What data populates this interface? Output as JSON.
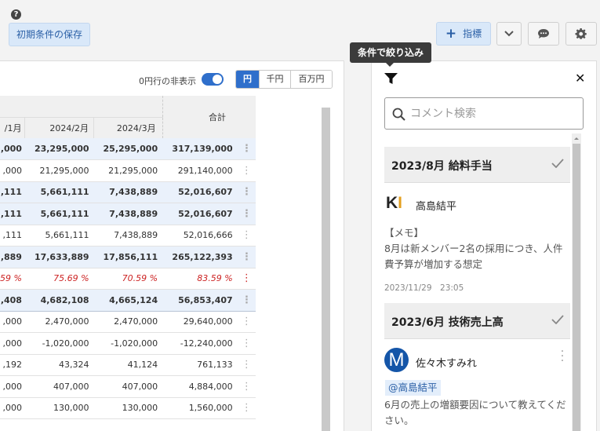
{
  "toolbar": {
    "help_glyph": "?",
    "save_conditions": "初期条件の保存",
    "metric_plus": "+",
    "metric_label": "指標",
    "filter_tooltip": "条件で絞り込み"
  },
  "table_panel": {
    "hide_zero_label": "0円行の非表示",
    "units": [
      "円",
      "千円",
      "百万円"
    ],
    "active_unit": "円",
    "headers": [
      "/1月",
      "2024/2月",
      "2024/3月"
    ],
    "total_header": "合計",
    "rows": [
      {
        "style": "hl",
        "cells": [
          ",000",
          "23,295,000",
          "25,295,000",
          "317,139,000"
        ]
      },
      {
        "style": "",
        "cells": [
          ",000",
          "21,295,000",
          "21,295,000",
          "291,140,000"
        ]
      },
      {
        "style": "hl",
        "cells": [
          ",111",
          "5,661,111",
          "7,438,889",
          "52,016,607"
        ]
      },
      {
        "style": "hl",
        "cells": [
          ",111",
          "5,661,111",
          "7,438,889",
          "52,016,607"
        ]
      },
      {
        "style": "",
        "cells": [
          ",111",
          "5,661,111",
          "7,438,889",
          "52,016,666"
        ]
      },
      {
        "style": "hl",
        "cells": [
          ",889",
          "17,633,889",
          "17,856,111",
          "265,122,393"
        ]
      },
      {
        "style": "pct",
        "cells": [
          "59 %",
          "75.69 %",
          "70.59 %",
          "83.59 %"
        ]
      },
      {
        "style": "hl",
        "cells": [
          ",408",
          "4,682,108",
          "4,665,124",
          "56,853,407"
        ]
      },
      {
        "style": "",
        "cells": [
          ",000",
          "2,470,000",
          "2,470,000",
          "29,640,000"
        ]
      },
      {
        "style": "",
        "cells": [
          ",000",
          "-1,020,000",
          "-1,020,000",
          "-12,240,000"
        ]
      },
      {
        "style": "",
        "cells": [
          ",192",
          "43,324",
          "41,124",
          "761,133"
        ]
      },
      {
        "style": "",
        "cells": [
          ",000",
          "407,000",
          "407,000",
          "4,884,000"
        ]
      },
      {
        "style": "",
        "cells": [
          ",000",
          "130,000",
          "130,000",
          "1,560,000"
        ]
      }
    ]
  },
  "comments_panel": {
    "close_glyph": "✕",
    "search_placeholder": "コメント検索",
    "threads": [
      {
        "title": "2023/8月 給料手当",
        "avatar_k": "K",
        "avatar_i": "I",
        "user": "高島結平",
        "body": "【メモ】\n8月は新メンバー2名の採用につき、人件費予算が増加する想定",
        "timestamp": "2023/11/29　23:05"
      },
      {
        "title": "2023/6月 技術売上高",
        "avatar": "M",
        "user": "佐々木すみれ",
        "mention": "@高島結平",
        "body": "6月の売上の増額要因について教えてください。"
      }
    ]
  },
  "colors": {
    "accent": "#2f6fcb",
    "highlight_row": "#eaf1fb",
    "negative_pct": "#cc2222",
    "avatar_m": "#1455a8"
  }
}
